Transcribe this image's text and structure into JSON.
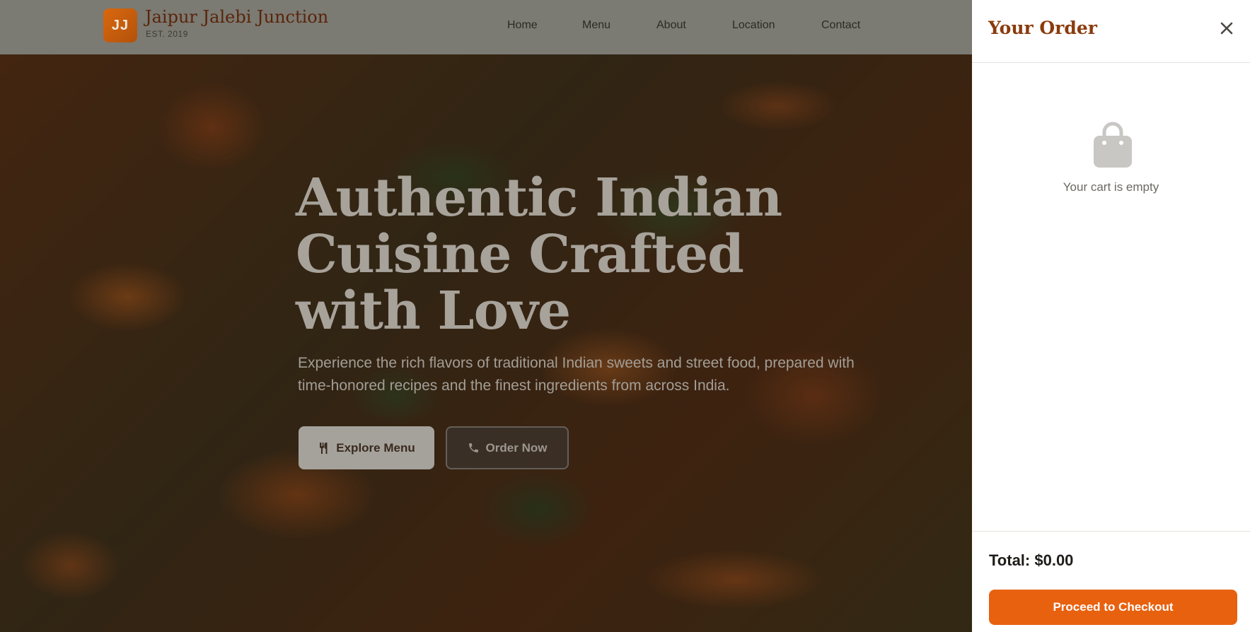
{
  "brand": {
    "logo_initials": "JJ",
    "name": "Jaipur Jalebi Junction",
    "established": "EST. 2019"
  },
  "nav": {
    "items": [
      {
        "label": "Home"
      },
      {
        "label": "Menu"
      },
      {
        "label": "About"
      },
      {
        "label": "Location"
      },
      {
        "label": "Contact"
      }
    ]
  },
  "hero": {
    "title": "Authentic Indian Cuisine Crafted with Love",
    "subtitle": "Experience the rich flavors of traditional Indian sweets and street food, prepared with time-honored recipes and the finest ingredients from across India.",
    "explore_button": {
      "label": "Explore Menu",
      "icon": "utensils-icon"
    },
    "order_button": {
      "label": "Order Now",
      "icon": "phone-icon"
    }
  },
  "cart": {
    "title": "Your Order",
    "close_icon": "close-icon",
    "empty_icon": "shopping-bag-icon",
    "empty_text": "Your cart is empty",
    "total_label": "Total: $0.00",
    "checkout_label": "Proceed to Checkout"
  },
  "colors": {
    "accent": "#e8610f",
    "brand_dark": "#8a3b0c",
    "header_bg": "#7b7a73",
    "panel_bg": "#ffffff"
  }
}
